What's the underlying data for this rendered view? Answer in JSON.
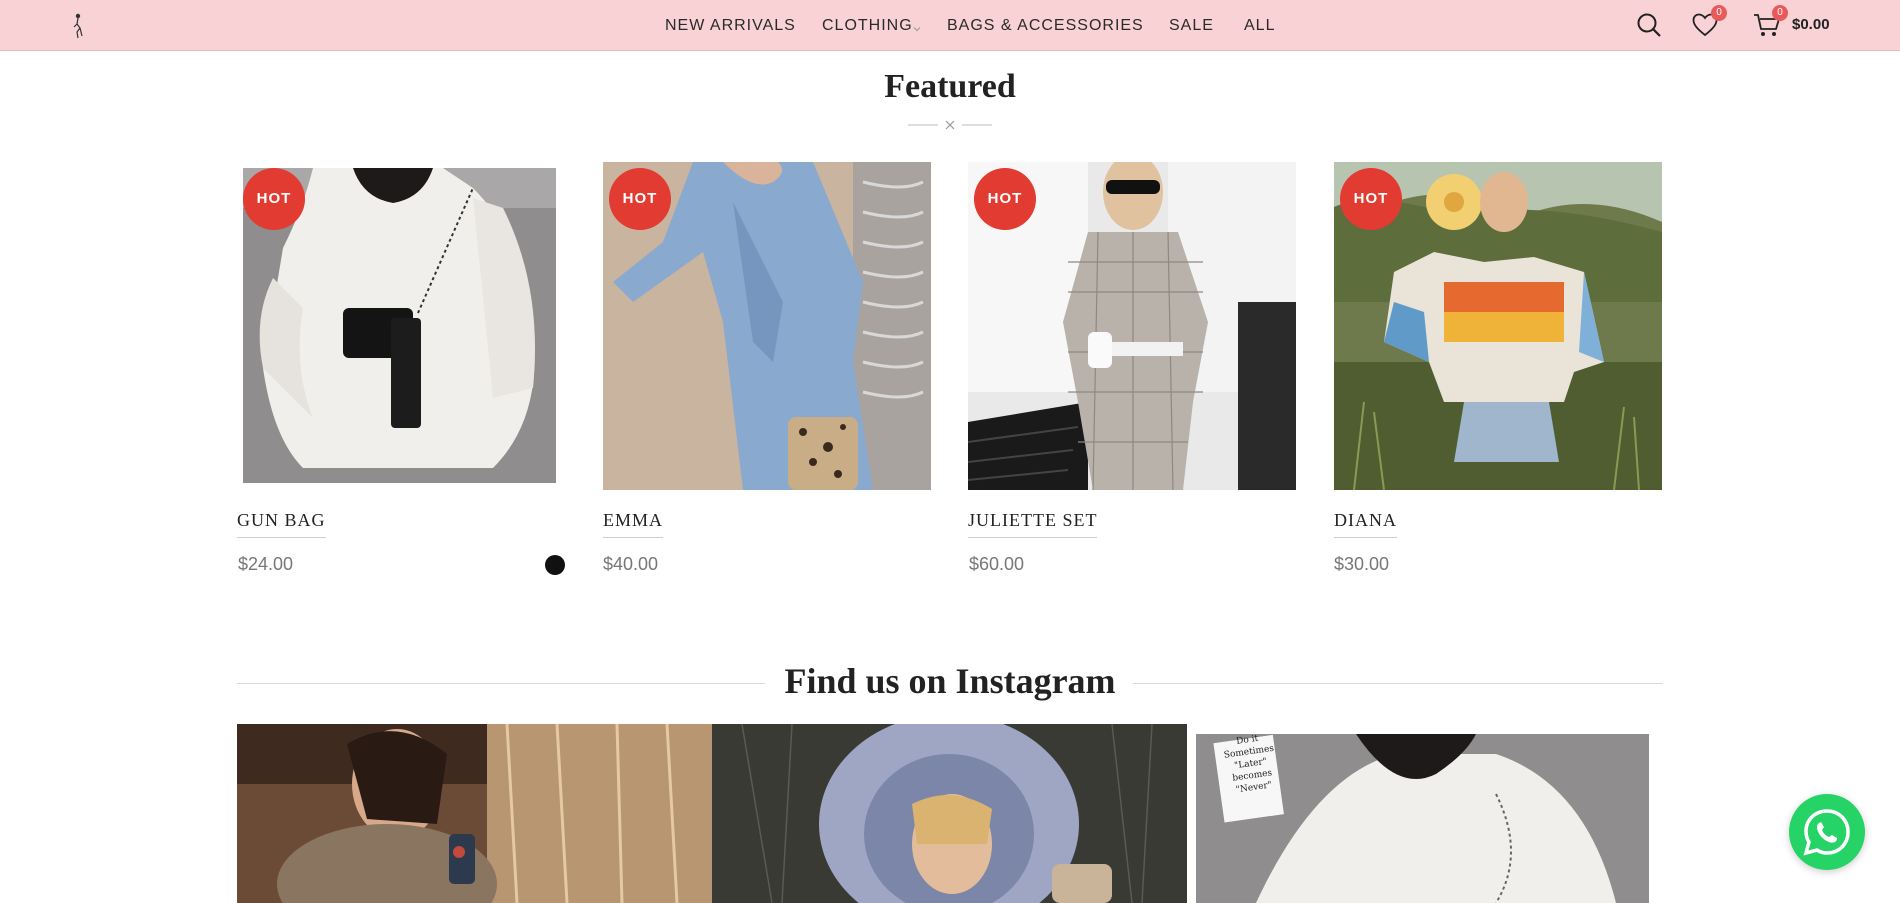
{
  "header": {
    "logo_icon": "fashion-figure-logo-icon",
    "nav": [
      {
        "label": "NEW ARRIVALS"
      },
      {
        "label": "CLOTHING",
        "has_dropdown": true
      },
      {
        "label": "BAGS & ACCESSORIES"
      },
      {
        "label": "SALE"
      },
      {
        "label": "ALL"
      }
    ],
    "search_icon": "search-icon",
    "wishlist_icon": "heart-icon",
    "wishlist_count": "0",
    "cart_icon": "cart-icon",
    "cart_count": "0",
    "cart_total": "$0.00"
  },
  "featured": {
    "title": "Featured",
    "products": [
      {
        "name": "GUN BAG",
        "price": "$24.00",
        "badge": "HOT",
        "swatches": [
          "#111111"
        ]
      },
      {
        "name": "EMMA",
        "price": "$40.00",
        "badge": "HOT"
      },
      {
        "name": "JULIETTE SET",
        "price": "$60.00",
        "badge": "HOT"
      },
      {
        "name": "DIANA",
        "price": "$30.00",
        "badge": "HOT"
      }
    ]
  },
  "instagram": {
    "title": "Find us on Instagram",
    "note_text": [
      "Do it",
      "Sometimes",
      "\"Later\"",
      "becomes",
      "\"Never\""
    ]
  },
  "whatsapp_icon": "whatsapp-icon",
  "colors": {
    "header_bg": "#f8d2d4",
    "hot_badge": "#e23b32",
    "counter_badge": "#e85b5b",
    "whatsapp": "#25d366"
  }
}
